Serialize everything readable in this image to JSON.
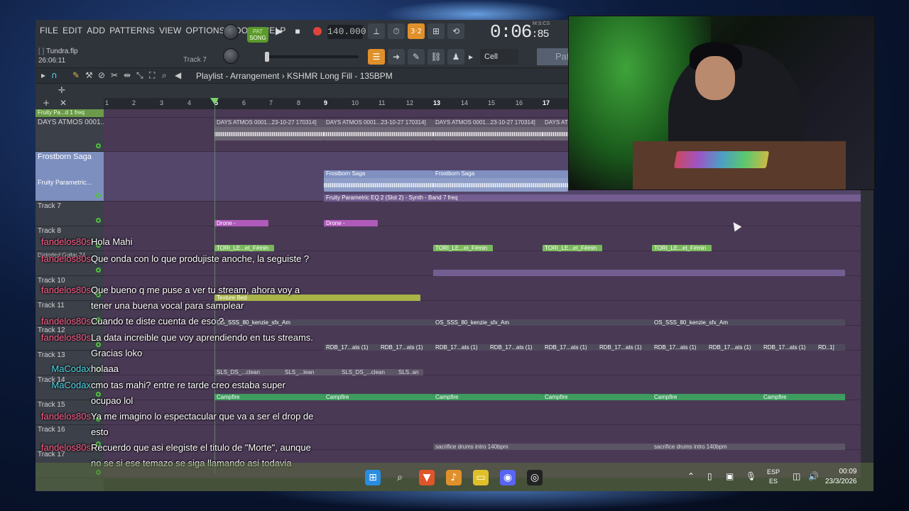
{
  "menu": [
    "FILE",
    "EDIT",
    "ADD",
    "PATTERNS",
    "VIEW",
    "OPTIONS",
    "TOOLS",
    "HELP"
  ],
  "project": {
    "file": "Tundra.flp",
    "elapsed": "26:06:11",
    "track_hint": "Track 7"
  },
  "transport": {
    "mode_top": "PAT",
    "mode_bottom": "SONG",
    "play": "▶",
    "stop": "■",
    "tempo": "140.000",
    "time_main": "0:06",
    "time_frac": "85",
    "time_unit": "M:S:CS"
  },
  "snap": {
    "value": "Cell"
  },
  "pattern_tab": "Patt",
  "playlist": {
    "title": "Playlist - Arrangement  ›  KSHMR Long Fill - 135BPM"
  },
  "ruler": [
    "1",
    "2",
    "3",
    "4",
    "5",
    "6",
    "7",
    "8",
    "9",
    "10",
    "11",
    "12",
    "13",
    "14",
    "15",
    "16",
    "17"
  ],
  "tracks": [
    {
      "name": "Fruity Pa...d 1 freq"
    },
    {
      "name": "DAYS ATMOS 0001..."
    },
    {
      "name": "Frostborn Saga"
    },
    {
      "name": "Fruity Parametric..."
    },
    {
      "name": "Track 7"
    },
    {
      "name": "Track 8"
    },
    {
      "name": "Distorted Guitar 24"
    },
    {
      "name": "Track 10"
    },
    {
      "name": "Track 11"
    },
    {
      "name": "Track 12"
    },
    {
      "name": "Track 13"
    },
    {
      "name": "Track 14"
    },
    {
      "name": "Track 15"
    },
    {
      "name": "Track 16"
    },
    {
      "name": "Track 17"
    }
  ],
  "clips": {
    "atmos": "DAYS ATMOS 0001...23-10-27 170314]",
    "frostborn": "Frostborn Saga",
    "eq": "Fruity Parametric EQ 2 (Slot 2) - Synth - Band 7 freq",
    "drone": "Drone -",
    "tori": "TORI_LE...et_F#min",
    "texture": "Texture Bed",
    "os_sss": "OS_SSS_80_kenzie_sfx_Am",
    "rdb": "RDB_17...ats (1)",
    "rdb_last": "RD..1]",
    "sls": "SLS_DS_...clean",
    "sls_a": "SLS_...lean",
    "sls_b": "SLS..an",
    "campfire": "Campfire",
    "sacrifice": "sacrifice drums intro 140bpm"
  },
  "chat": [
    {
      "user": "fandelos80s",
      "text": "Hola Mahi",
      "color": "#ff5c8a"
    },
    {
      "user": "fandelos80s",
      "text": "Que onda con lo que produjiste anoche, la seguiste ?",
      "color": "#ff5c8a"
    },
    {
      "user": "fandelos80s",
      "text": "Que bueno q me puse a ver tu stream, ahora voy a tener una buena vocal para samplear",
      "color": "#ff5c8a"
    },
    {
      "user": "fandelos80s",
      "text": "Cuando te diste cuenta de eso ?",
      "color": "#ff5c8a"
    },
    {
      "user": "fandelos80s",
      "text": "La data increible que voy aprendiendo en tus streams. Gracias loko",
      "color": "#ff5c8a"
    },
    {
      "user": "MaCodax",
      "text": "holaaa",
      "color": "#4fd9e8"
    },
    {
      "user": "MaCodax",
      "text": "cmo tas mahi? entre re tarde creo estaba super ocupao lol",
      "color": "#4fd9e8"
    },
    {
      "user": "fandelos80s",
      "text": "Ya me imagino lo espectacular que va a ser el drop de esto",
      "color": "#ff5c8a"
    },
    {
      "user": "fandelos80s",
      "text": "Recuerdo que asi elegiste el titulo de \"Morte\", aunque no se si ese temazo se siga llamando asi todavia",
      "color": "#ff5c8a"
    }
  ],
  "taskbar": {
    "icons": [
      "windows-start",
      "search",
      "brave",
      "fl-studio",
      "file-explorer",
      "discord",
      "obs"
    ],
    "lang_top": "ESP",
    "lang_bottom": "ES",
    "time": "00:09",
    "date": "23/3/2026"
  }
}
